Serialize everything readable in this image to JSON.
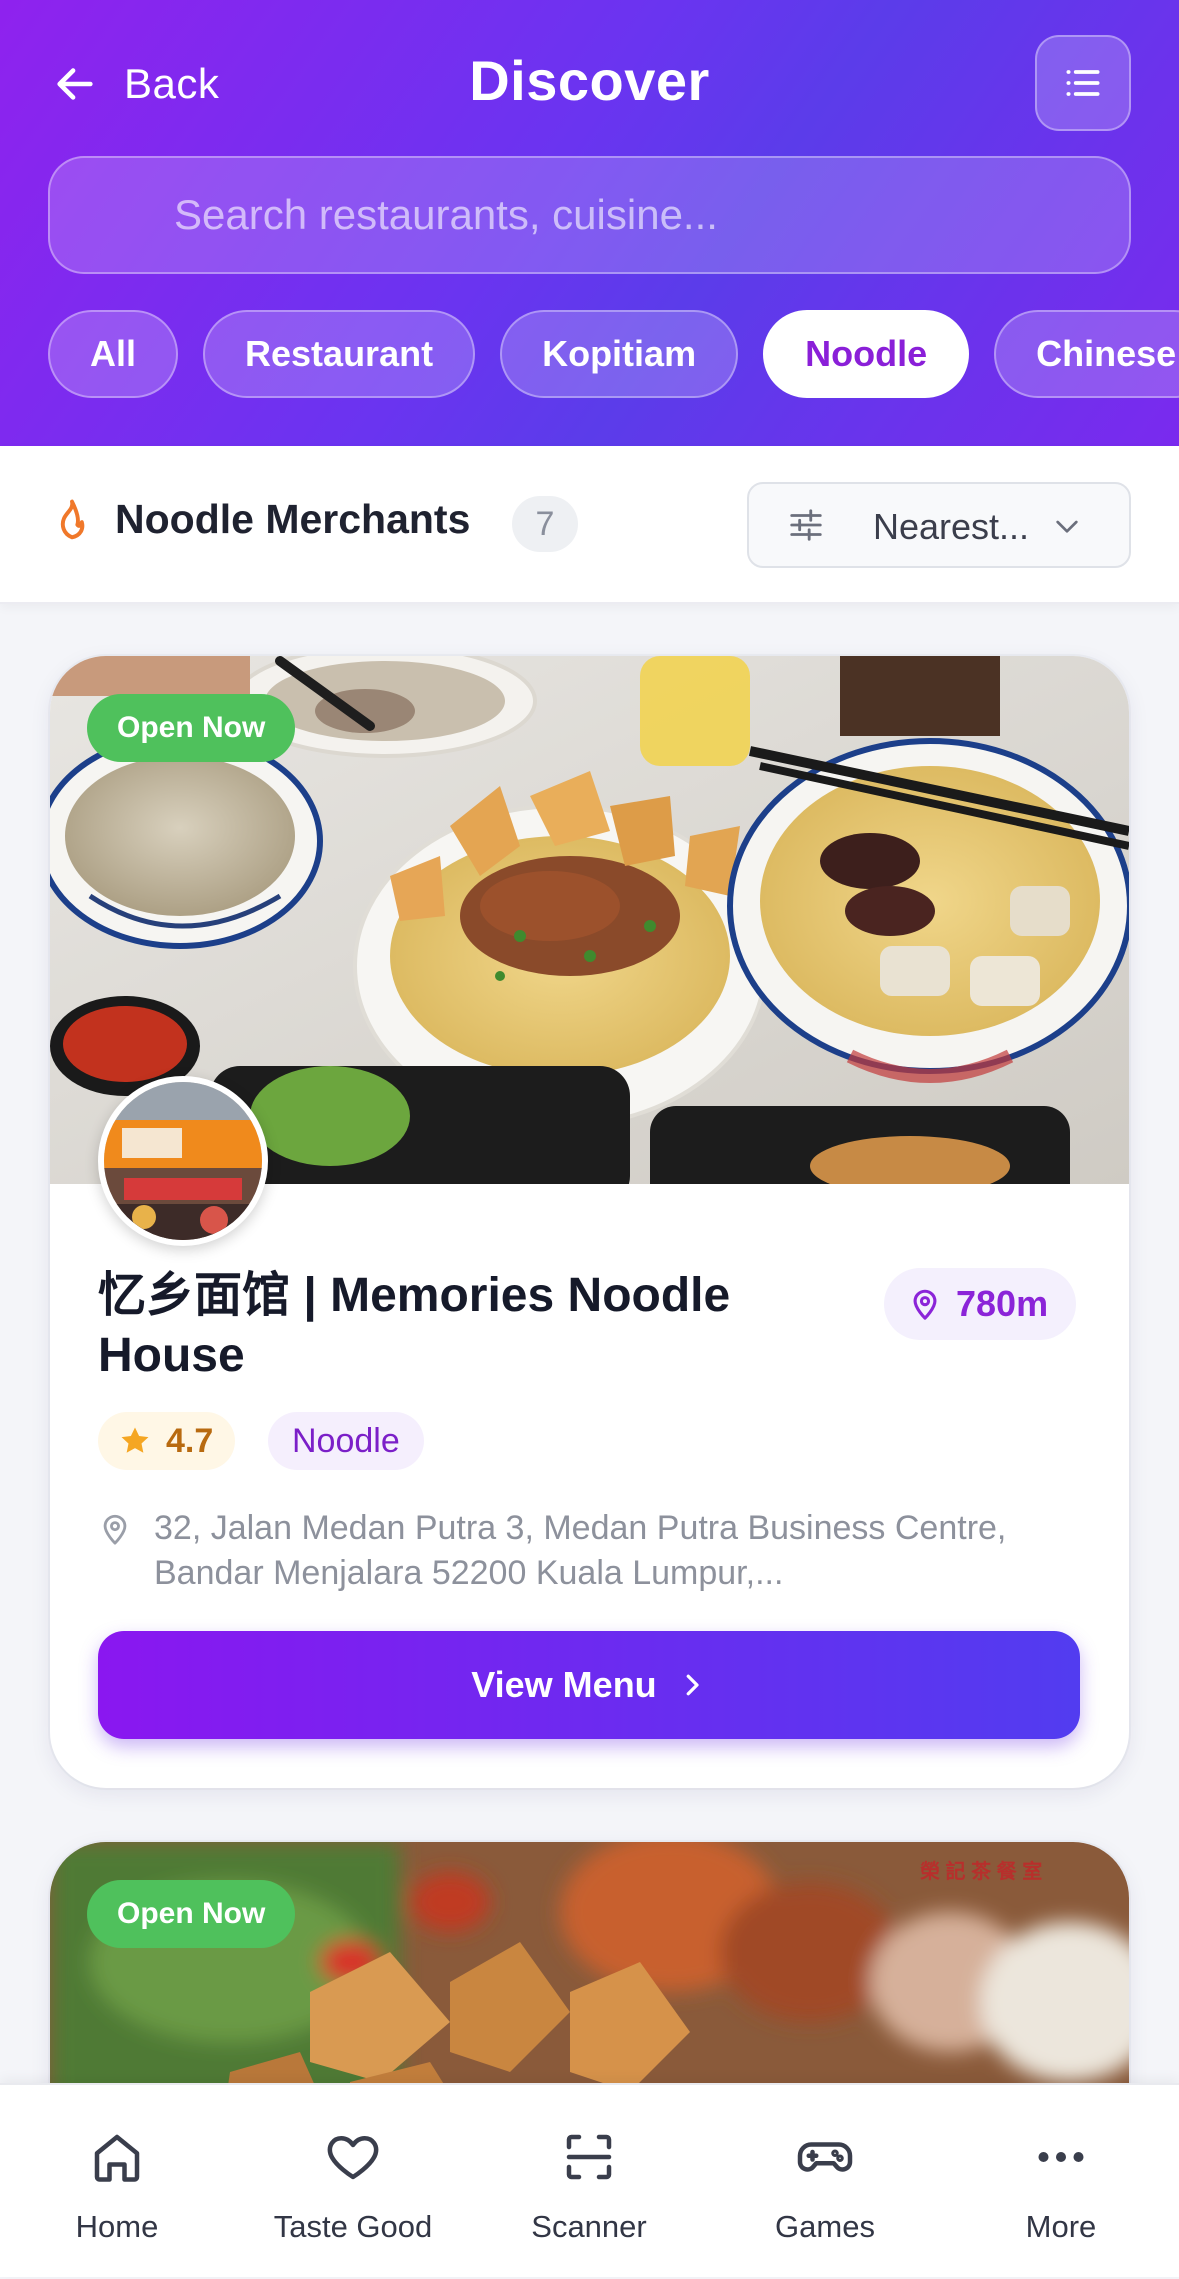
{
  "header": {
    "back_label": "Back",
    "title": "Discover",
    "search_placeholder": "Search restaurants, cuisine..."
  },
  "chips": [
    {
      "label": "All",
      "active": false
    },
    {
      "label": "Restaurant",
      "active": false
    },
    {
      "label": "Kopitiam",
      "active": false
    },
    {
      "label": "Noodle",
      "active": true
    },
    {
      "label": "Chinese",
      "active": false
    }
  ],
  "section": {
    "title": "Noodle Merchants",
    "count": "7",
    "sort_label": "Nearest..."
  },
  "merchants": [
    {
      "open_status": "Open Now",
      "name": "忆乡面馆 | Memories Noodle House",
      "distance": "780m",
      "rating": "4.7",
      "cuisine": "Noodle",
      "address": "32, Jalan Medan Putra 3, Medan Putra Business Centre, Bandar Menjalara 52200 Kuala Lumpur,...",
      "cta_label": "View Menu"
    },
    {
      "open_status": "Open Now"
    }
  ],
  "bottom_nav": [
    {
      "label": "Home",
      "icon": "home-icon"
    },
    {
      "label": "Taste Good",
      "icon": "heart-icon"
    },
    {
      "label": "Scanner",
      "icon": "scanner-icon"
    },
    {
      "label": "Games",
      "icon": "gamepad-icon"
    },
    {
      "label": "More",
      "icon": "more-dots-icon"
    }
  ],
  "colors": {
    "brand_purple": "#8a1fd8",
    "header_gradient_start": "#8f22ee",
    "header_gradient_end": "#5b3cea",
    "open_green": "#4fc15c",
    "rating_amber": "#f5a623"
  }
}
